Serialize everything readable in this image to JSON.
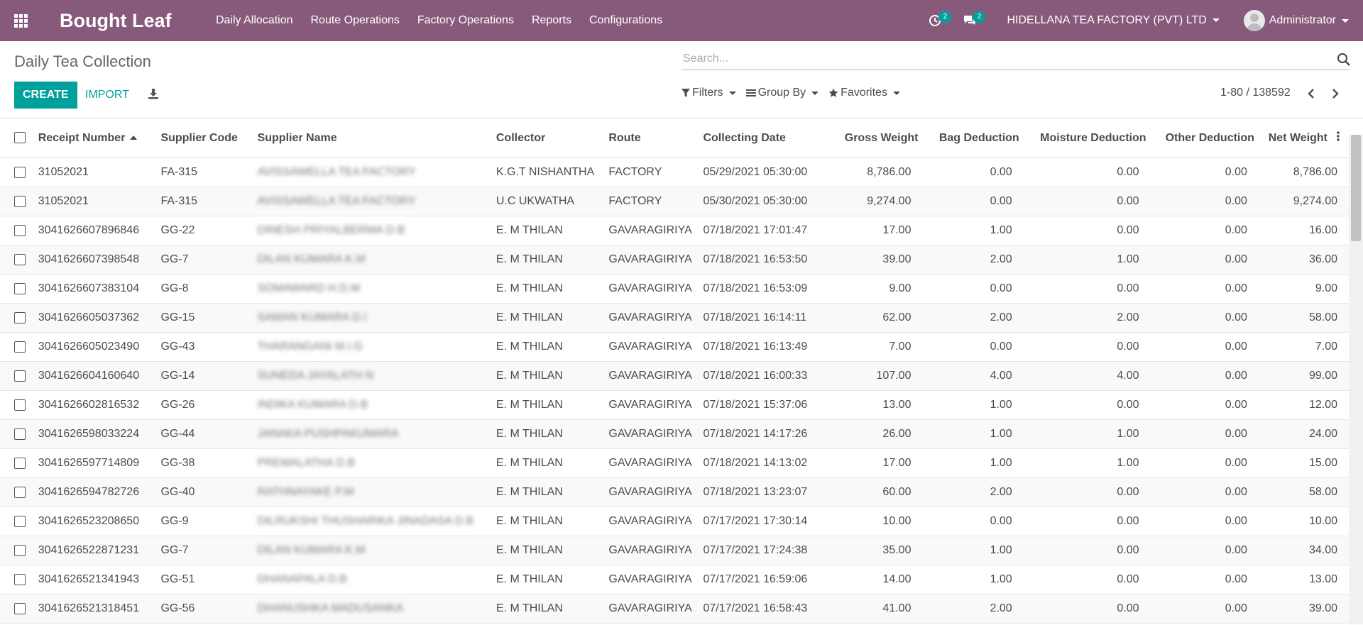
{
  "navbar": {
    "app_name": "Bought Leaf",
    "menu": [
      "Daily Allocation",
      "Route Operations",
      "Factory Operations",
      "Reports",
      "Configurations"
    ],
    "activity_count": "2",
    "messages_count": "2",
    "company": "HIDELLANA TEA FACTORY (PVT) LTD",
    "user": "Administrator"
  },
  "control_panel": {
    "breadcrumb": "Daily Tea Collection",
    "search_placeholder": "Search...",
    "create_label": "CREATE",
    "import_label": "IMPORT",
    "filters_label": "Filters",
    "group_by_label": "Group By",
    "favorites_label": "Favorites",
    "pager": "1-80 / 138592"
  },
  "table": {
    "columns": [
      "Receipt Number",
      "Supplier Code",
      "Supplier Name",
      "Collector",
      "Route",
      "Collecting Date",
      "Gross Weight",
      "Bag Deduction",
      "Moisture Deduction",
      "Other Deduction",
      "Net Weight"
    ],
    "rows": [
      [
        "31052021",
        "FA-315",
        "AVISSAWELLA TEA FACTORY",
        "K.G.T NISHANTHA",
        "FACTORY",
        "05/29/2021 05:30:00",
        "8,786.00",
        "0.00",
        "0.00",
        "0.00",
        "8,786.00"
      ],
      [
        "31052021",
        "FA-315",
        "AVISSAWELLA TEA FACTORY",
        "U.C UKWATHA",
        "FACTORY",
        "05/30/2021 05:30:00",
        "9,274.00",
        "0.00",
        "0.00",
        "0.00",
        "9,274.00"
      ],
      [
        "3041626607896846",
        "GG-22",
        "DINESH PRIYALBERMA D.B",
        "E. M THILAN",
        "GAVARAGIRIYA",
        "07/18/2021 17:01:47",
        "17.00",
        "1.00",
        "0.00",
        "0.00",
        "16.00"
      ],
      [
        "3041626607398548",
        "GG-7",
        "DILAN KUMARA K.M",
        "E. M THILAN",
        "GAVARAGIRIYA",
        "07/18/2021 16:53:50",
        "39.00",
        "2.00",
        "1.00",
        "0.00",
        "36.00"
      ],
      [
        "3041626607383104",
        "GG-8",
        "SOMAWARD H.D.M",
        "E. M THILAN",
        "GAVARAGIRIYA",
        "07/18/2021 16:53:09",
        "9.00",
        "0.00",
        "0.00",
        "0.00",
        "9.00"
      ],
      [
        "3041626605037362",
        "GG-15",
        "SAMAN KUMARA D.I",
        "E. M THILAN",
        "GAVARAGIRIYA",
        "07/18/2021 16:14:11",
        "62.00",
        "2.00",
        "2.00",
        "0.00",
        "58.00"
      ],
      [
        "3041626605023490",
        "GG-43",
        "THARANGANI M.I.G",
        "E. M THILAN",
        "GAVARAGIRIYA",
        "07/18/2021 16:13:49",
        "7.00",
        "0.00",
        "0.00",
        "0.00",
        "7.00"
      ],
      [
        "3041626604160640",
        "GG-14",
        "SUNEDA JAYALATH N",
        "E. M THILAN",
        "GAVARAGIRIYA",
        "07/18/2021 16:00:33",
        "107.00",
        "4.00",
        "4.00",
        "0.00",
        "99.00"
      ],
      [
        "3041626602816532",
        "GG-26",
        "INDIKA KUMARA D.B",
        "E. M THILAN",
        "GAVARAGIRIYA",
        "07/18/2021 15:37:06",
        "13.00",
        "1.00",
        "0.00",
        "0.00",
        "12.00"
      ],
      [
        "3041626598033224",
        "GG-44",
        "JANAKA PUSHPAKUMARA",
        "E. M THILAN",
        "GAVARAGIRIYA",
        "07/18/2021 14:17:26",
        "26.00",
        "1.00",
        "1.00",
        "0.00",
        "24.00"
      ],
      [
        "3041626597714809",
        "GG-38",
        "PREMALATHA D.B",
        "E. M THILAN",
        "GAVARAGIRIYA",
        "07/18/2021 14:13:02",
        "17.00",
        "1.00",
        "1.00",
        "0.00",
        "15.00"
      ],
      [
        "3041626594782726",
        "GG-40",
        "RATHNAYAKE P.M",
        "E. M THILAN",
        "GAVARAGIRIYA",
        "07/18/2021 13:23:07",
        "60.00",
        "2.00",
        "0.00",
        "0.00",
        "58.00"
      ],
      [
        "3041626523208650",
        "GG-9",
        "DILRUKSHI THUSHARIKA JINADASA D.B",
        "E. M THILAN",
        "GAVARAGIRIYA",
        "07/17/2021 17:30:14",
        "10.00",
        "0.00",
        "0.00",
        "0.00",
        "10.00"
      ],
      [
        "3041626522871231",
        "GG-7",
        "DILAN KUMARA K.M",
        "E. M THILAN",
        "GAVARAGIRIYA",
        "07/17/2021 17:24:38",
        "35.00",
        "1.00",
        "0.00",
        "0.00",
        "34.00"
      ],
      [
        "3041626521341943",
        "GG-51",
        "DHANAPALA D.B",
        "E. M THILAN",
        "GAVARAGIRIYA",
        "07/17/2021 16:59:06",
        "14.00",
        "1.00",
        "0.00",
        "0.00",
        "13.00"
      ],
      [
        "3041626521318451",
        "GG-56",
        "DHANUSHKA MADUSANKA",
        "E. M THILAN",
        "GAVARAGIRIYA",
        "07/17/2021 16:58:43",
        "41.00",
        "2.00",
        "0.00",
        "0.00",
        "39.00"
      ]
    ],
    "blurred_column": 2
  },
  "colors": {
    "navbar": "#875a7b",
    "accent": "#00a09d",
    "text": "#4c4c4c"
  },
  "icons": [
    "apps-grid-icon",
    "activity-clock-icon",
    "chat-bubbles-icon",
    "search-icon",
    "download-icon",
    "filter-icon",
    "list-icon",
    "star-icon",
    "chevron-left-icon",
    "chevron-right-icon",
    "column-options-icon"
  ]
}
